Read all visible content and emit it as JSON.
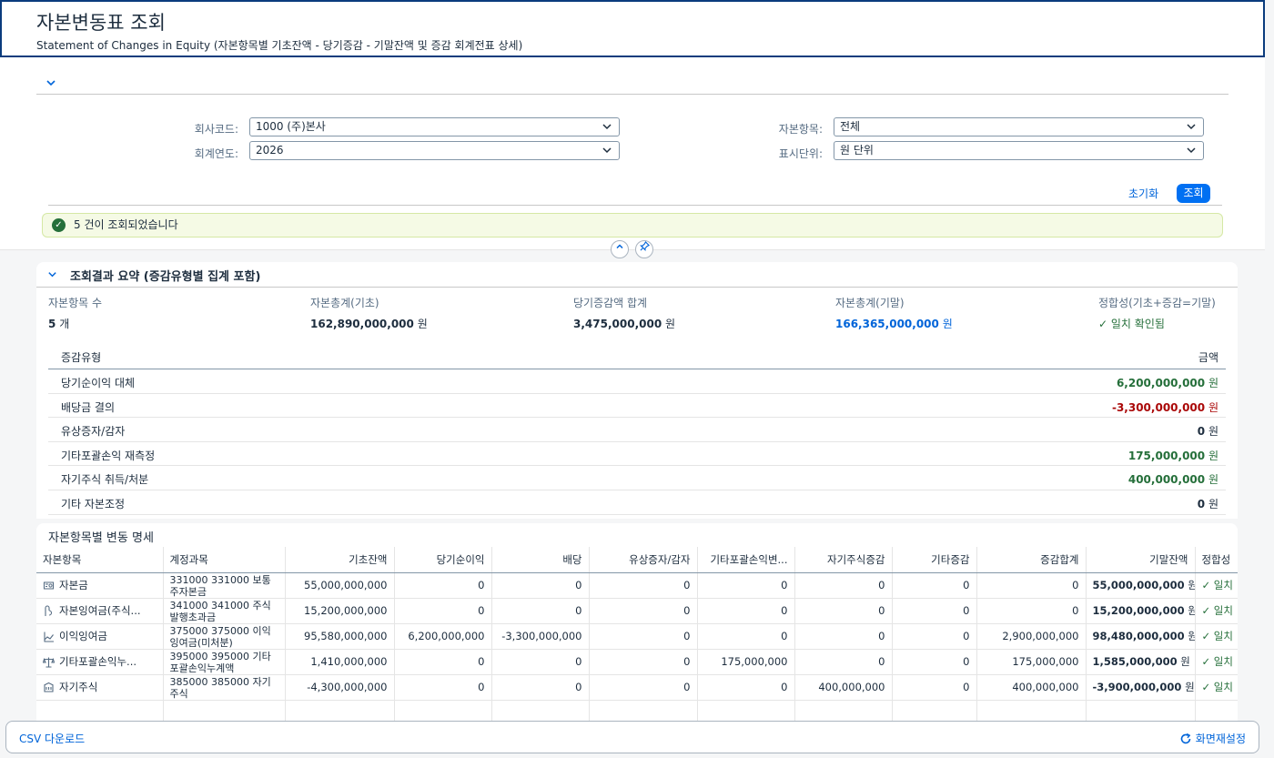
{
  "header": {
    "title": "자본변동표 조회",
    "subtitle": "Statement of Changes in Equity (자본항목별 기초잔액 - 당기증감 - 기말잔액 및 증감 회계전표 상세)"
  },
  "filters": {
    "company_label": "회사코드:",
    "company_value": "1000 (주)본사",
    "year_label": "회계연도:",
    "year_value": "2026",
    "equity_item_label": "자본항목:",
    "equity_item_value": "전체",
    "unit_label": "표시단위:",
    "unit_value": "원 단위",
    "reset_label": "초기화",
    "search_label": "조회"
  },
  "message": {
    "text": "5 건이 조회되었습니다"
  },
  "summary": {
    "title": "조회결과 요약 (증감유형별 집계 포함)",
    "kpis": {
      "count_label": "자본항목 수",
      "count_value": "5",
      "count_unit": "개",
      "begin_label": "자본총계(기초)",
      "begin_value": "162,890,000,000",
      "begin_unit": "원",
      "change_label": "당기증감액 합계",
      "change_value": "3,475,000,000",
      "change_unit": "원",
      "end_label": "자본총계(기말)",
      "end_value": "166,365,000,000",
      "end_unit": "원",
      "check_label": "정합성(기초+증감=기말)",
      "check_value": "일치 확인됨"
    },
    "type_header": "증감유형",
    "amount_header": "금액",
    "types": [
      {
        "name": "당기순이익 대체",
        "amount": "6,200,000,000",
        "unit": "원",
        "tone": "green"
      },
      {
        "name": "배당금 결의",
        "amount": "-3,300,000,000",
        "unit": "원",
        "tone": "red"
      },
      {
        "name": "유상증자/감자",
        "amount": "0",
        "unit": "원",
        "tone": "neutral"
      },
      {
        "name": "기타포괄손익 재측정",
        "amount": "175,000,000",
        "unit": "원",
        "tone": "green"
      },
      {
        "name": "자기주식 취득/처분",
        "amount": "400,000,000",
        "unit": "원",
        "tone": "green"
      },
      {
        "name": "기타 자본조정",
        "amount": "0",
        "unit": "원",
        "tone": "neutral"
      }
    ]
  },
  "detail": {
    "title": "자본항목별 변동 명세",
    "columns": [
      "자본항목",
      "계정과목",
      "기초잔액",
      "당기순이익",
      "배당",
      "유상증자/감자",
      "기타포괄손익변...",
      "자기주식증감",
      "기타증감",
      "증감합계",
      "기말잔액",
      "정합성"
    ],
    "rows": [
      {
        "icon": "capital-stock-icon",
        "item": "자본금",
        "account": "331000 331000 보통 주자본금",
        "begin": "55,000,000,000",
        "ni": "0",
        "div": "0",
        "cap": "0",
        "oci": "0",
        "treasury": "0",
        "other": "0",
        "total": "0",
        "end": "55,000,000,000",
        "unit": "원",
        "check": "일치"
      },
      {
        "icon": "capital-surplus-icon",
        "item": "자본잉여금(주식...",
        "account": "341000 341000 주식 발행초과금",
        "begin": "15,200,000,000",
        "ni": "0",
        "div": "0",
        "cap": "0",
        "oci": "0",
        "treasury": "0",
        "other": "0",
        "total": "0",
        "end": "15,200,000,000",
        "unit": "원",
        "check": "일치"
      },
      {
        "icon": "retained-earnings-icon",
        "item": "이익잉여금",
        "account": "375000 375000 이익 잉여금(미처분)",
        "begin": "95,580,000,000",
        "ni": "6,200,000,000",
        "div": "-3,300,000,000",
        "cap": "0",
        "oci": "0",
        "treasury": "0",
        "other": "0",
        "total": "2,900,000,000",
        "end": "98,480,000,000",
        "unit": "원",
        "check": "일치"
      },
      {
        "icon": "balance-scale-icon",
        "item": "기타포괄손익누...",
        "account": "395000 395000 기타 포괄손익누계액",
        "begin": "1,410,000,000",
        "ni": "0",
        "div": "0",
        "cap": "0",
        "oci": "175,000,000",
        "treasury": "0",
        "other": "0",
        "total": "175,000,000",
        "end": "1,585,000,000",
        "unit": "원",
        "check": "일치"
      },
      {
        "icon": "treasury-stock-icon",
        "item": "자기주식",
        "account": "385000 385000 자기 주식",
        "begin": "-4,300,000,000",
        "ni": "0",
        "div": "0",
        "cap": "0",
        "oci": "0",
        "treasury": "400,000,000",
        "other": "0",
        "total": "400,000,000",
        "end": "-3,900,000,000",
        "unit": "원",
        "check": "일치"
      }
    ]
  },
  "footer": {
    "csv_label": "CSV 다운로드",
    "reset_layout_label": "화면재설정"
  },
  "colors": {
    "accent": "#0070f2",
    "link": "#0064d9",
    "positive": "#256f3a",
    "negative": "#aa0808",
    "header_border": "#0a3c7d"
  }
}
